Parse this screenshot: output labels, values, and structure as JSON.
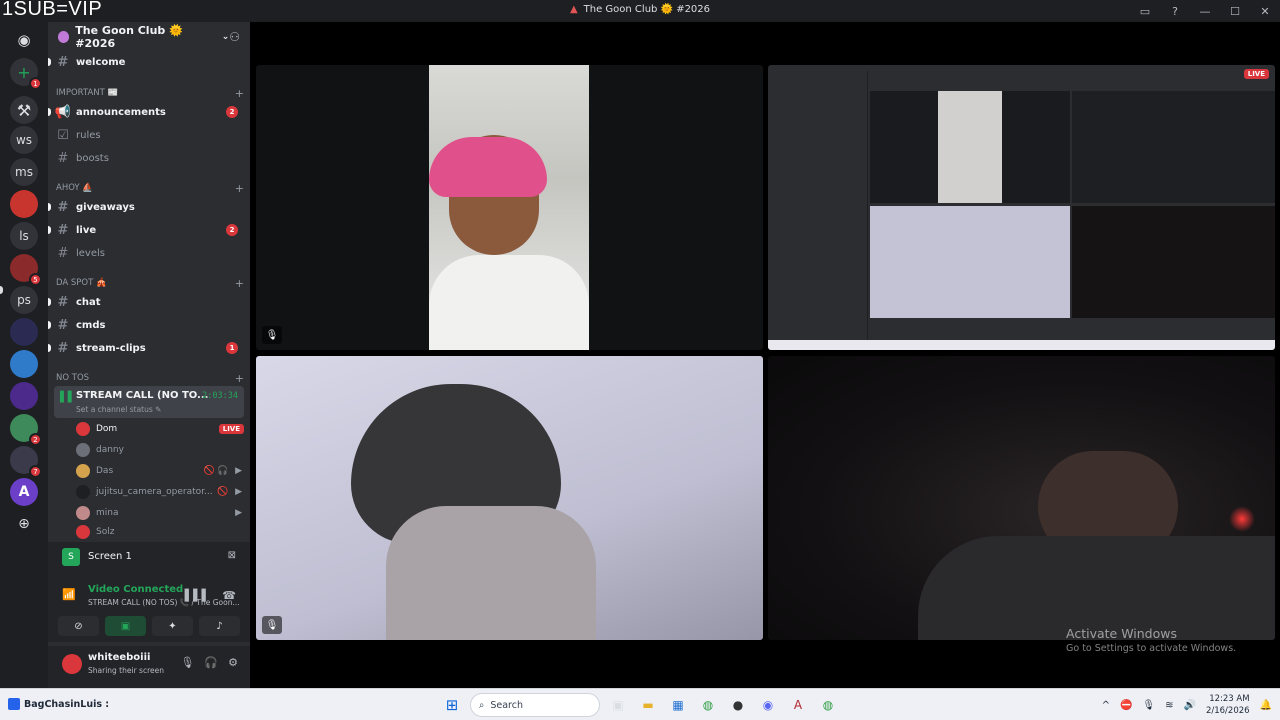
{
  "overlay_text": "1SUB=VIP",
  "window": {
    "title": "The Goon Club 🌞 #2026",
    "controls": [
      "inbox-icon",
      "help-icon",
      "minimize",
      "maximize",
      "close"
    ]
  },
  "servers": [
    {
      "label": "discord-home",
      "glyph": "◉"
    },
    {
      "label": "add-server",
      "glyph": "+",
      "badge": "1"
    },
    {
      "label": "server-tool",
      "glyph": "⚒"
    },
    {
      "label": "ws",
      "glyph": "ws"
    },
    {
      "label": "ms",
      "glyph": "ms"
    },
    {
      "label": "server-red",
      "glyph": ""
    },
    {
      "label": "ls",
      "glyph": "ls"
    },
    {
      "label": "server-avatar",
      "glyph": "",
      "badge": "5"
    },
    {
      "label": "ps",
      "glyph": "ps"
    },
    {
      "label": "server-goonworld",
      "glyph": ""
    },
    {
      "label": "server-blue",
      "glyph": ""
    },
    {
      "label": "server-purple",
      "glyph": ""
    },
    {
      "label": "server-green",
      "glyph": "",
      "badge": "2"
    },
    {
      "label": "server-goon",
      "glyph": "",
      "badge": "7"
    },
    {
      "label": "server-a",
      "glyph": "A"
    },
    {
      "label": "discover",
      "glyph": "⊕"
    }
  ],
  "guild": {
    "name": "The Goon Club 🌞 #2026",
    "invite_icon": "add-member-icon"
  },
  "channels": {
    "welcome": "welcome",
    "cat_important": "IMPORTANT 📰",
    "announcements": "announcements",
    "announcements_count": "2",
    "rules": "rules",
    "boosts": "boosts",
    "cat_ahoy": "AHOY ⛵",
    "giveaways": "giveaways",
    "live": "live",
    "live_count": "2",
    "levels": "levels",
    "cat_daspot": "DA SPOT 🎪",
    "chat": "chat",
    "cmds": "cmds",
    "stream_clips": "stream-clips",
    "stream_clips_count": "1",
    "cat_notos": "NO TOS"
  },
  "voice": {
    "channel_name": "STREAM CALL (NO TO...",
    "timer": "2:03:34",
    "status": "Set a channel status ✎",
    "users": [
      {
        "name": "Dom",
        "badge": "LIVE",
        "bold": true,
        "color": "#da373c"
      },
      {
        "name": "danny",
        "icons": "",
        "bold": false,
        "color": "#6d6f78"
      },
      {
        "name": "Das",
        "icons": "🚫🎧 ▶",
        "bold": false,
        "color": "#d4a24c"
      },
      {
        "name": "jujitsu_camera_operator...",
        "icons": "🚫 ▶",
        "bold": false,
        "color": "#2b2d31"
      },
      {
        "name": "mina",
        "icons": "▶",
        "bold": false,
        "color": "#c08a8a"
      },
      {
        "name": "Solz",
        "icons": "",
        "bold": false,
        "color": "#da373c"
      }
    ]
  },
  "screen_panel": {
    "label": "Screen 1"
  },
  "vc_panel": {
    "title": "Video Connected",
    "subtitle": "STREAM CALL (NO TOS) 📞 / The Goon...",
    "buttons": [
      "camera-off",
      "screen-share",
      "activities",
      "soundboard"
    ]
  },
  "user": {
    "name": "whiteeboiii",
    "status": "Sharing their screen"
  },
  "tiles": {
    "mute_icon": "mic-off-icon"
  },
  "activate_windows": {
    "title": "Activate Windows",
    "subtitle": "Go to Settings to activate Windows."
  },
  "mini_stream": {
    "live": "LIVE"
  },
  "taskbar": {
    "left_label": "BagChasinLuis :",
    "search_placeholder": "Search",
    "time": "12:23 AM",
    "date": "2/16/2026"
  }
}
